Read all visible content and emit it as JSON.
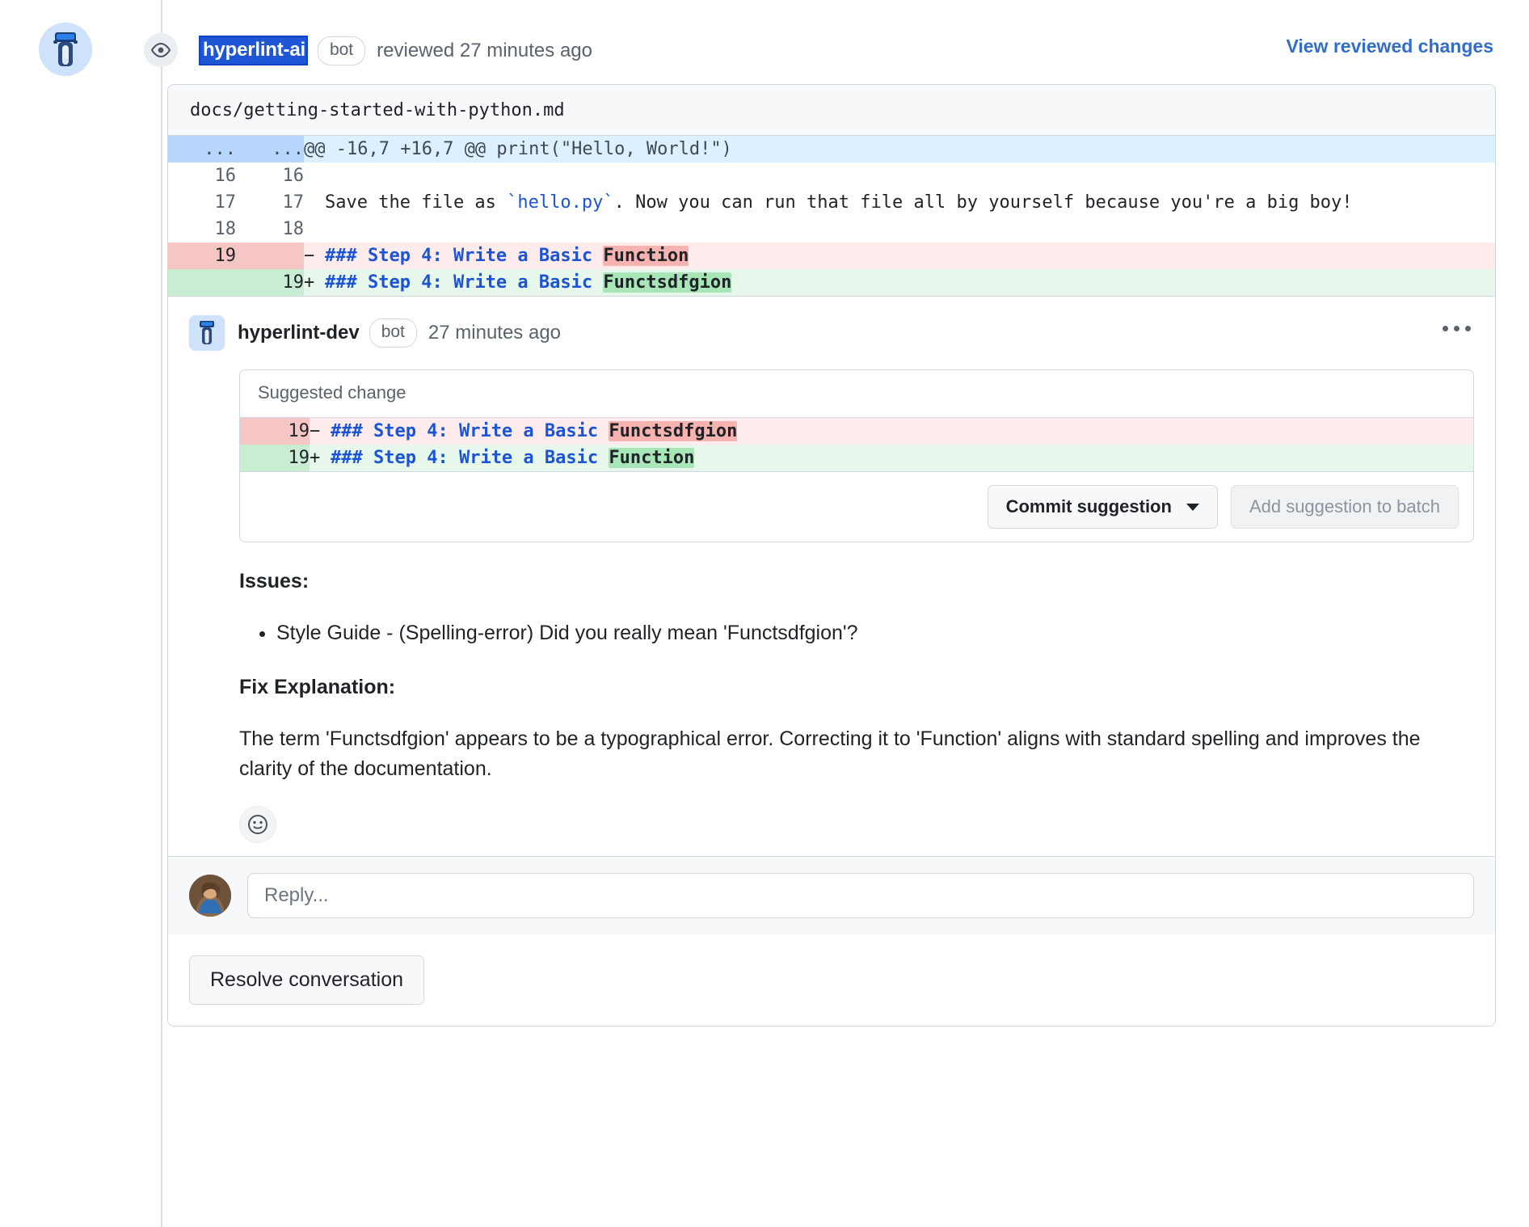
{
  "review_header": {
    "avatar_name": "hyperlint-ai-avatar",
    "eye_icon": "eye-icon",
    "username": "hyperlint-ai",
    "bot_label": "bot",
    "action_text": "reviewed 27 minutes ago",
    "view_changes_label": "View reviewed changes",
    "link_color": "#316dca",
    "selection_color": "#1e56d6"
  },
  "diff": {
    "filename": "docs/getting-started-with-python.md",
    "rows": [
      {
        "type": "hunk",
        "ln_old": "...",
        "ln_new": "...",
        "marker": "",
        "text": "@@ -16,7 +16,7 @@ print(\"Hello, World!\")"
      },
      {
        "type": "ctx",
        "ln_old": "16",
        "ln_new": "16",
        "marker": "",
        "text": ""
      },
      {
        "type": "ctx",
        "ln_old": "17",
        "ln_new": "17",
        "marker": "",
        "text": "Save the file as `hello.py`. Now you can run that file all by yourself because you're a big boy!",
        "code_token": "`hello.py`"
      },
      {
        "type": "ctx",
        "ln_old": "18",
        "ln_new": "18",
        "marker": "",
        "text": ""
      },
      {
        "type": "del",
        "ln_old": "19",
        "ln_new": "",
        "marker": "−",
        "heading_hashes": "###",
        "heading_text": " Step 4: Write a Basic ",
        "word_diff": "Function"
      },
      {
        "type": "add",
        "ln_old": "",
        "ln_new": "19",
        "marker": "+",
        "heading_hashes": "###",
        "heading_text": " Step 4: Write a Basic ",
        "word_diff": "Functsdfgion"
      }
    ]
  },
  "comment": {
    "avatar_name": "hyperlint-dev-avatar",
    "author": "hyperlint-dev",
    "bot_label": "bot",
    "timestamp": "27 minutes ago",
    "menu_label": "···",
    "suggestion": {
      "title": "Suggested change",
      "rows": [
        {
          "type": "del",
          "ln": "19",
          "marker": "−",
          "heading_hashes": "###",
          "heading_text": " Step 4: Write a Basic ",
          "word_diff": "Functsdfgion"
        },
        {
          "type": "add",
          "ln": "19",
          "marker": "+",
          "heading_hashes": "###",
          "heading_text": " Step 4: Write a Basic ",
          "word_diff": "Function"
        }
      ],
      "commit_label": "Commit suggestion",
      "batch_label": "Add suggestion to batch",
      "batch_disabled": true
    },
    "body": {
      "issues_heading": "Issues:",
      "issues": [
        "Style Guide - (Spelling-error) Did you really mean 'Functsdfgion'?"
      ],
      "fix_heading": "Fix Explanation:",
      "fix_text": "The term 'Functsdfgion' appears to be a typographical error. Correcting it to 'Function' aligns with standard spelling and improves the clarity of the documentation."
    },
    "reaction_icon": "smiley-icon"
  },
  "reply": {
    "avatar_name": "current-user-avatar",
    "placeholder": "Reply..."
  },
  "footer": {
    "resolve_label": "Resolve conversation"
  }
}
